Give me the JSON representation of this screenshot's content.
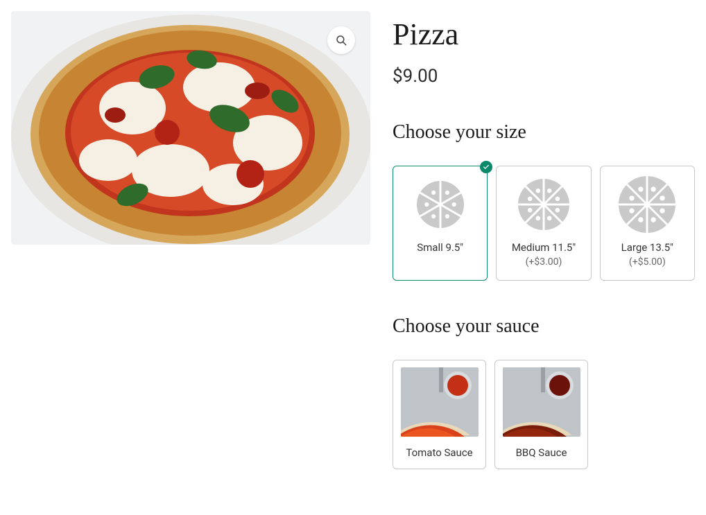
{
  "product": {
    "title": "Pizza",
    "price": "$9.00"
  },
  "size_section": {
    "heading": "Choose your size",
    "options": [
      {
        "label": "Small 9.5\"",
        "extra": "",
        "selected": true,
        "slices": 6,
        "svgSize": 68
      },
      {
        "label": "Medium 11.5\"",
        "extra": "(+$3.00)",
        "selected": false,
        "slices": 8,
        "svgSize": 74
      },
      {
        "label": "Large 13.5\"",
        "extra": "(+$5.00)",
        "selected": false,
        "slices": 8,
        "svgSize": 82
      }
    ]
  },
  "sauce_section": {
    "heading": "Choose your sauce",
    "options": [
      {
        "label": "Tomato Sauce",
        "selected": false,
        "variant": "tomato"
      },
      {
        "label": "BBQ Sauce",
        "selected": false,
        "variant": "bbq"
      }
    ]
  },
  "icons": {
    "zoom": "magnifier-icon",
    "check": "check-icon"
  }
}
